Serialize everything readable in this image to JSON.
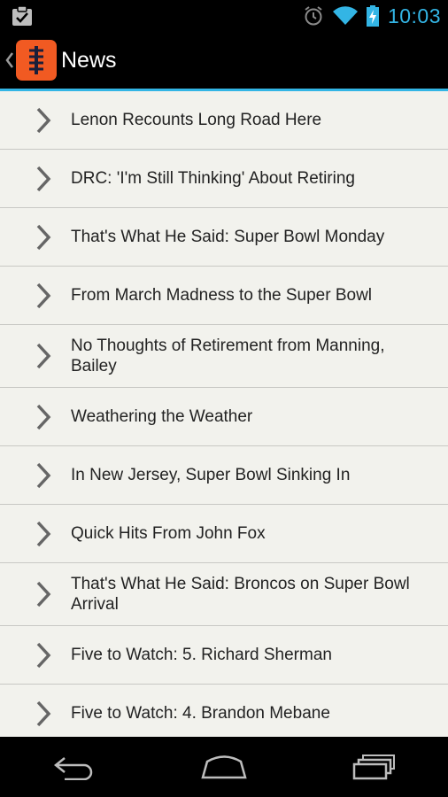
{
  "status_bar": {
    "time": "10:03",
    "icons": [
      "clipboard-check-icon",
      "alarm-icon",
      "wifi-icon",
      "battery-charging-icon"
    ]
  },
  "action_bar": {
    "title": "News",
    "app_icon": "football-app-icon",
    "brand_color": "#f15a22"
  },
  "news": {
    "items": [
      {
        "title": "Lenon Recounts Long Road Here"
      },
      {
        "title": "DRC: 'I'm Still Thinking' About Retiring"
      },
      {
        "title": "That's What He Said: Super Bowl Monday"
      },
      {
        "title": "From March Madness to the Super Bowl"
      },
      {
        "title": "No Thoughts of Retirement from Manning, Bailey"
      },
      {
        "title": "Weathering the Weather"
      },
      {
        "title": "In New Jersey, Super Bowl Sinking In"
      },
      {
        "title": "Quick Hits From John Fox"
      },
      {
        "title": "That's What He Said: Broncos on Super Bowl Arrival"
      },
      {
        "title": "Five to Watch: 5. Richard Sherman"
      },
      {
        "title": "Five to Watch: 4. Brandon Mebane"
      }
    ]
  },
  "nav_bar": {
    "buttons": [
      "back-icon",
      "home-icon",
      "recent-apps-icon"
    ]
  },
  "colors": {
    "accent": "#33b5e5",
    "list_background": "#f2f2ed",
    "chevron": "#666666"
  }
}
